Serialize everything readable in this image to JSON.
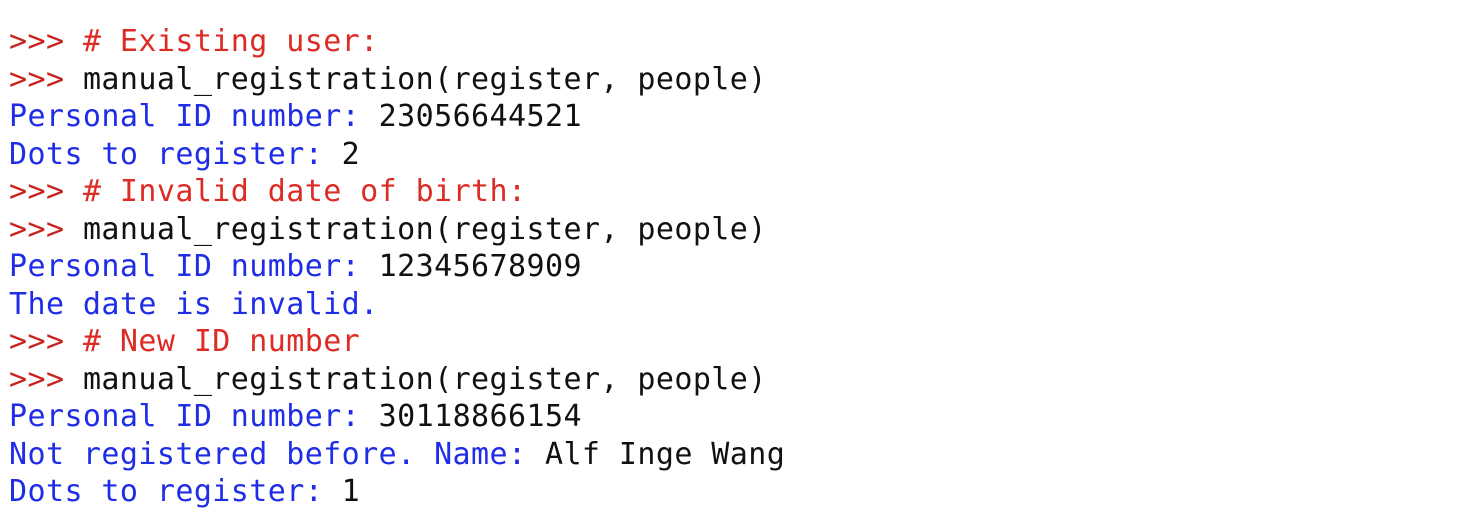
{
  "console": {
    "lines": [
      {
        "prompt": ">>> ",
        "comment": "# Existing user:"
      },
      {
        "prompt": ">>> ",
        "code": "manual_registration(register, people)"
      },
      {
        "output": "Personal ID number: ",
        "input": "23056644521"
      },
      {
        "output": "Dots to register: ",
        "input": "2"
      },
      {
        "prompt": ">>> ",
        "comment": "# Invalid date of birth:"
      },
      {
        "prompt": ">>> ",
        "code": "manual_registration(register, people)"
      },
      {
        "output": "Personal ID number: ",
        "input": "12345678909"
      },
      {
        "output": "The date is invalid."
      },
      {
        "prompt": ">>> ",
        "comment": "# New ID number"
      },
      {
        "prompt": ">>> ",
        "code": "manual_registration(register, people)"
      },
      {
        "output": "Personal ID number: ",
        "input": "30118866154"
      },
      {
        "output": "Not registered before. Name: ",
        "input": "Alf Inge Wang"
      },
      {
        "output": "Dots to register: ",
        "input": "1"
      }
    ]
  },
  "colors": {
    "prompt": "#c8221f",
    "comment": "#dd2b25",
    "code": "#111111",
    "stdout": "#1f2de6",
    "stdin": "#111111",
    "background": "#ffffff"
  }
}
